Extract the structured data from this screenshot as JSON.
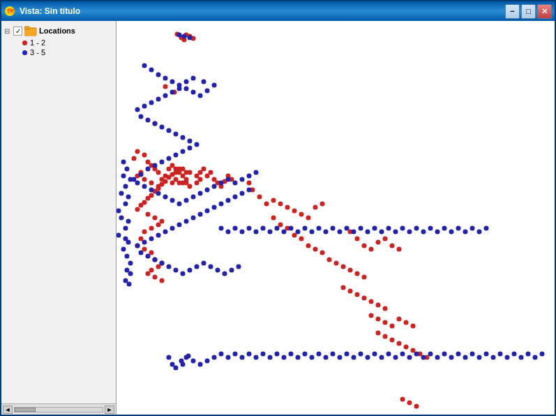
{
  "window": {
    "title": "Vista: Sin título",
    "minimize_label": "−",
    "maximize_label": "□",
    "close_label": "✕"
  },
  "sidebar": {
    "layer_name": "Locations",
    "legend": [
      {
        "label": "1 - 2",
        "color": "#CC2222"
      },
      {
        "label": "3 - 5",
        "color": "#2222CC"
      }
    ],
    "scrollbar_left": "◄",
    "scrollbar_right": "►"
  },
  "dots": {
    "red": [
      [
        252,
        47
      ],
      [
        265,
        48
      ],
      [
        270,
        50
      ],
      [
        258,
        52
      ],
      [
        275,
        53
      ],
      [
        262,
        55
      ],
      [
        235,
        122
      ],
      [
        248,
        130
      ],
      [
        220,
        175
      ],
      [
        195,
        215
      ],
      [
        205,
        220
      ],
      [
        190,
        225
      ],
      [
        210,
        230
      ],
      [
        215,
        235
      ],
      [
        220,
        240
      ],
      [
        200,
        245
      ],
      [
        195,
        250
      ],
      [
        205,
        255
      ],
      [
        215,
        260
      ],
      [
        225,
        265
      ],
      [
        230,
        255
      ],
      [
        235,
        250
      ],
      [
        225,
        245
      ],
      [
        240,
        240
      ],
      [
        245,
        235
      ],
      [
        250,
        240
      ],
      [
        255,
        245
      ],
      [
        260,
        250
      ],
      [
        265,
        255
      ],
      [
        260,
        260
      ],
      [
        250,
        255
      ],
      [
        245,
        260
      ],
      [
        255,
        260
      ],
      [
        270,
        265
      ],
      [
        265,
        260
      ],
      [
        280,
        260
      ],
      [
        285,
        255
      ],
      [
        295,
        250
      ],
      [
        305,
        255
      ],
      [
        310,
        260
      ],
      [
        315,
        265
      ],
      [
        320,
        258
      ],
      [
        325,
        250
      ],
      [
        330,
        255
      ],
      [
        300,
        245
      ],
      [
        290,
        240
      ],
      [
        285,
        245
      ],
      [
        280,
        250
      ],
      [
        270,
        245
      ],
      [
        265,
        245
      ],
      [
        260,
        240
      ],
      [
        255,
        240
      ],
      [
        250,
        245
      ],
      [
        245,
        248
      ],
      [
        240,
        252
      ],
      [
        235,
        258
      ],
      [
        230,
        262
      ],
      [
        225,
        268
      ],
      [
        220,
        272
      ],
      [
        215,
        278
      ],
      [
        210,
        282
      ],
      [
        205,
        288
      ],
      [
        200,
        292
      ],
      [
        195,
        298
      ],
      [
        210,
        305
      ],
      [
        220,
        310
      ],
      [
        230,
        315
      ],
      [
        225,
        320
      ],
      [
        215,
        325
      ],
      [
        205,
        330
      ],
      [
        200,
        340
      ],
      [
        195,
        350
      ],
      [
        205,
        355
      ],
      [
        215,
        360
      ],
      [
        220,
        370
      ],
      [
        230,
        375
      ],
      [
        225,
        380
      ],
      [
        215,
        385
      ],
      [
        210,
        390
      ],
      [
        220,
        395
      ],
      [
        230,
        400
      ],
      [
        355,
        260
      ],
      [
        360,
        270
      ],
      [
        370,
        280
      ],
      [
        380,
        290
      ],
      [
        390,
        285
      ],
      [
        400,
        290
      ],
      [
        410,
        295
      ],
      [
        420,
        300
      ],
      [
        430,
        305
      ],
      [
        440,
        310
      ],
      [
        450,
        295
      ],
      [
        460,
        290
      ],
      [
        390,
        310
      ],
      [
        400,
        320
      ],
      [
        410,
        325
      ],
      [
        420,
        335
      ],
      [
        430,
        340
      ],
      [
        440,
        350
      ],
      [
        450,
        355
      ],
      [
        460,
        360
      ],
      [
        470,
        370
      ],
      [
        480,
        375
      ],
      [
        490,
        380
      ],
      [
        500,
        385
      ],
      [
        510,
        390
      ],
      [
        520,
        395
      ],
      [
        490,
        410
      ],
      [
        500,
        415
      ],
      [
        510,
        420
      ],
      [
        520,
        425
      ],
      [
        530,
        430
      ],
      [
        540,
        435
      ],
      [
        550,
        440
      ],
      [
        530,
        450
      ],
      [
        540,
        455
      ],
      [
        550,
        460
      ],
      [
        560,
        465
      ],
      [
        570,
        455
      ],
      [
        580,
        460
      ],
      [
        590,
        465
      ],
      [
        540,
        475
      ],
      [
        550,
        480
      ],
      [
        560,
        485
      ],
      [
        570,
        490
      ],
      [
        580,
        495
      ],
      [
        590,
        500
      ],
      [
        600,
        505
      ],
      [
        610,
        510
      ],
      [
        500,
        330
      ],
      [
        510,
        340
      ],
      [
        520,
        350
      ],
      [
        530,
        355
      ],
      [
        540,
        345
      ],
      [
        550,
        340
      ],
      [
        560,
        350
      ],
      [
        570,
        355
      ],
      [
        575,
        570
      ],
      [
        585,
        575
      ],
      [
        595,
        580
      ]
    ],
    "blue": [
      [
        255,
        48
      ],
      [
        270,
        52
      ],
      [
        262,
        50
      ],
      [
        205,
        92
      ],
      [
        215,
        98
      ],
      [
        225,
        105
      ],
      [
        235,
        110
      ],
      [
        245,
        115
      ],
      [
        255,
        120
      ],
      [
        265,
        125
      ],
      [
        275,
        130
      ],
      [
        285,
        135
      ],
      [
        295,
        128
      ],
      [
        305,
        120
      ],
      [
        290,
        115
      ],
      [
        275,
        110
      ],
      [
        265,
        115
      ],
      [
        255,
        125
      ],
      [
        245,
        130
      ],
      [
        235,
        135
      ],
      [
        225,
        140
      ],
      [
        215,
        145
      ],
      [
        205,
        150
      ],
      [
        195,
        155
      ],
      [
        200,
        165
      ],
      [
        210,
        170
      ],
      [
        220,
        175
      ],
      [
        230,
        180
      ],
      [
        240,
        185
      ],
      [
        250,
        190
      ],
      [
        260,
        195
      ],
      [
        270,
        200
      ],
      [
        280,
        205
      ],
      [
        270,
        210
      ],
      [
        260,
        215
      ],
      [
        250,
        220
      ],
      [
        240,
        225
      ],
      [
        230,
        230
      ],
      [
        220,
        235
      ],
      [
        210,
        240
      ],
      [
        200,
        248
      ],
      [
        190,
        255
      ],
      [
        195,
        260
      ],
      [
        205,
        265
      ],
      [
        215,
        270
      ],
      [
        225,
        275
      ],
      [
        235,
        280
      ],
      [
        245,
        285
      ],
      [
        255,
        290
      ],
      [
        265,
        285
      ],
      [
        275,
        280
      ],
      [
        285,
        275
      ],
      [
        295,
        270
      ],
      [
        305,
        265
      ],
      [
        315,
        260
      ],
      [
        325,
        255
      ],
      [
        335,
        260
      ],
      [
        345,
        255
      ],
      [
        355,
        250
      ],
      [
        365,
        245
      ],
      [
        355,
        270
      ],
      [
        345,
        275
      ],
      [
        335,
        280
      ],
      [
        325,
        285
      ],
      [
        315,
        290
      ],
      [
        305,
        295
      ],
      [
        295,
        300
      ],
      [
        285,
        305
      ],
      [
        275,
        310
      ],
      [
        265,
        315
      ],
      [
        255,
        320
      ],
      [
        245,
        325
      ],
      [
        235,
        330
      ],
      [
        225,
        335
      ],
      [
        215,
        340
      ],
      [
        205,
        345
      ],
      [
        195,
        350
      ],
      [
        200,
        360
      ],
      [
        210,
        365
      ],
      [
        220,
        370
      ],
      [
        230,
        375
      ],
      [
        240,
        380
      ],
      [
        250,
        385
      ],
      [
        260,
        390
      ],
      [
        270,
        385
      ],
      [
        280,
        380
      ],
      [
        290,
        375
      ],
      [
        300,
        380
      ],
      [
        310,
        385
      ],
      [
        320,
        390
      ],
      [
        330,
        385
      ],
      [
        340,
        380
      ],
      [
        175,
        230
      ],
      [
        180,
        240
      ],
      [
        175,
        250
      ],
      [
        185,
        255
      ],
      [
        178,
        265
      ],
      [
        172,
        275
      ],
      [
        182,
        280
      ],
      [
        178,
        290
      ],
      [
        168,
        300
      ],
      [
        172,
        310
      ],
      [
        182,
        315
      ],
      [
        178,
        325
      ],
      [
        168,
        335
      ],
      [
        178,
        340
      ],
      [
        182,
        345
      ],
      [
        175,
        355
      ],
      [
        180,
        365
      ],
      [
        185,
        375
      ],
      [
        180,
        385
      ],
      [
        185,
        390
      ],
      [
        178,
        400
      ],
      [
        183,
        405
      ],
      [
        265,
        510
      ],
      [
        260,
        520
      ],
      [
        240,
        510
      ],
      [
        245,
        520
      ],
      [
        250,
        525
      ],
      [
        258,
        515
      ],
      [
        268,
        508
      ],
      [
        275,
        515
      ],
      [
        285,
        520
      ],
      [
        295,
        515
      ],
      [
        305,
        510
      ],
      [
        315,
        505
      ],
      [
        325,
        510
      ],
      [
        335,
        505
      ],
      [
        345,
        510
      ],
      [
        355,
        505
      ],
      [
        365,
        510
      ],
      [
        375,
        505
      ],
      [
        385,
        510
      ],
      [
        395,
        505
      ],
      [
        405,
        510
      ],
      [
        415,
        505
      ],
      [
        425,
        510
      ],
      [
        435,
        505
      ],
      [
        445,
        510
      ],
      [
        455,
        505
      ],
      [
        465,
        510
      ],
      [
        475,
        505
      ],
      [
        485,
        510
      ],
      [
        495,
        505
      ],
      [
        505,
        510
      ],
      [
        515,
        505
      ],
      [
        525,
        510
      ],
      [
        535,
        505
      ],
      [
        545,
        510
      ],
      [
        555,
        505
      ],
      [
        565,
        510
      ],
      [
        575,
        505
      ],
      [
        585,
        510
      ],
      [
        595,
        505
      ],
      [
        605,
        510
      ],
      [
        615,
        505
      ],
      [
        625,
        510
      ],
      [
        635,
        505
      ],
      [
        645,
        510
      ],
      [
        655,
        505
      ],
      [
        665,
        510
      ],
      [
        675,
        505
      ],
      [
        685,
        510
      ],
      [
        695,
        505
      ],
      [
        705,
        510
      ],
      [
        715,
        505
      ],
      [
        725,
        510
      ],
      [
        735,
        505
      ],
      [
        745,
        510
      ],
      [
        755,
        505
      ],
      [
        765,
        510
      ],
      [
        775,
        505
      ],
      [
        315,
        325
      ],
      [
        325,
        330
      ],
      [
        335,
        325
      ],
      [
        345,
        330
      ],
      [
        355,
        325
      ],
      [
        365,
        330
      ],
      [
        375,
        325
      ],
      [
        385,
        330
      ],
      [
        395,
        325
      ],
      [
        405,
        330
      ],
      [
        415,
        325
      ],
      [
        425,
        330
      ],
      [
        435,
        325
      ],
      [
        445,
        330
      ],
      [
        455,
        325
      ],
      [
        465,
        330
      ],
      [
        475,
        325
      ],
      [
        485,
        330
      ],
      [
        495,
        325
      ],
      [
        505,
        330
      ],
      [
        515,
        325
      ],
      [
        525,
        330
      ],
      [
        535,
        325
      ],
      [
        545,
        330
      ],
      [
        555,
        325
      ],
      [
        565,
        330
      ],
      [
        575,
        325
      ],
      [
        585,
        330
      ],
      [
        595,
        325
      ],
      [
        605,
        330
      ],
      [
        615,
        325
      ],
      [
        625,
        330
      ],
      [
        635,
        325
      ],
      [
        645,
        330
      ],
      [
        655,
        325
      ],
      [
        665,
        330
      ],
      [
        675,
        325
      ],
      [
        685,
        330
      ],
      [
        695,
        325
      ]
    ]
  }
}
